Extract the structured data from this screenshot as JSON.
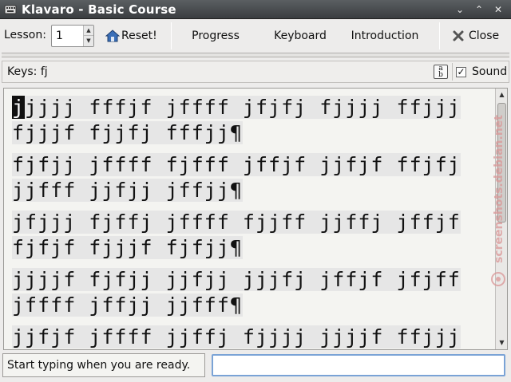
{
  "window": {
    "title": "Klavaro - Basic Course"
  },
  "toolbar": {
    "lesson_label": "Lesson:",
    "lesson_value": "1",
    "reset_label": "Reset!",
    "progress_label": "Progress",
    "keyboard_label": "Keyboard",
    "introduction_label": "Introduction",
    "close_label": "Close"
  },
  "keysbar": {
    "keys_label": "Keys:  fj",
    "sound_label": "Sound",
    "sound_checked": true
  },
  "exercise": {
    "cursor_char": "j",
    "first_line_rest": "jjjj fffjf jffff jfjfj fjjjj ffjjj",
    "lines": [
      "fjjjf fjjfj fffjj¶",
      "fjfjj jffff fjfff jffjf jjfjf ffjfj",
      "jjfff jjfjj jffjj¶",
      "jfjjj fjffj jffff fjjff jjffj jffjf",
      "fjfjf fjjjf fjfjj¶",
      "jjjjf fjfjj jjfjj jjjfj jffjf jfjff",
      "jffff jffjj jjfff¶",
      "jjfjf jffff jjffj fjjjj jjjjf ffjjj"
    ]
  },
  "status": {
    "message": "Start typing when you are ready.",
    "entry_value": ""
  },
  "watermark": {
    "text": "screenshots.debian.net"
  },
  "colors": {
    "titlebar": "#3a3d40",
    "cursor_bg": "#111111",
    "entry_focus": "#7aa3d6",
    "reset_icon": "#3a6fb8",
    "close_icon": "#555555"
  }
}
